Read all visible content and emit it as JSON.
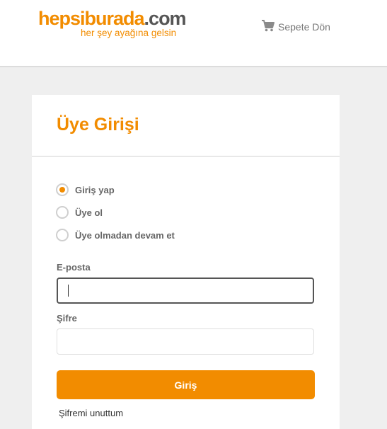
{
  "header": {
    "logo": {
      "brand": "hepsiburada",
      "domain": ".com",
      "tagline": "her şey ayağına gelsin"
    },
    "cart_link": {
      "icon": "cart-icon",
      "label": "Sepete Dön"
    }
  },
  "login": {
    "title": "Üye Girişi",
    "options": [
      {
        "label": "Giriş yap",
        "selected": true
      },
      {
        "label": "Üye ol",
        "selected": false
      },
      {
        "label": "Üye olmadan devam et",
        "selected": false
      }
    ],
    "email": {
      "label": "E-posta",
      "value": "",
      "placeholder": ""
    },
    "password": {
      "label": "Şifre",
      "value": "",
      "placeholder": ""
    },
    "submit_label": "Giriş",
    "forgot_label": "Şifremi unuttum"
  },
  "colors": {
    "accent": "#f28c00",
    "background": "#efefef",
    "text": "#666666"
  }
}
